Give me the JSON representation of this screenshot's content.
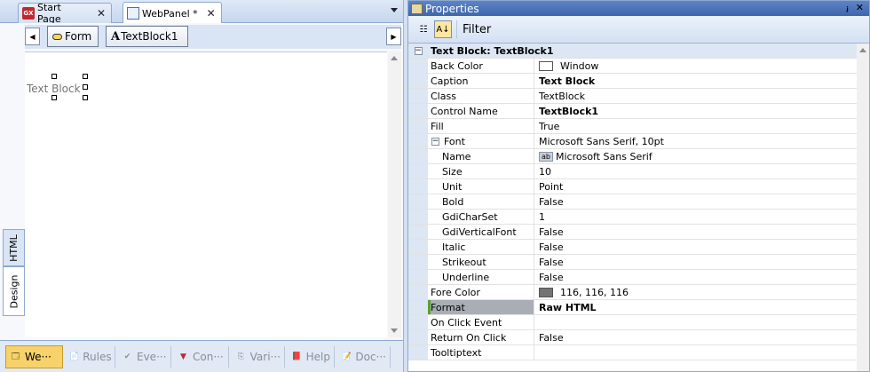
{
  "doc_tabs": [
    {
      "label": "Start Page",
      "icon": "gx-icon",
      "icon_text": "GX",
      "active": false
    },
    {
      "label": "WebPanel *",
      "icon": "webpanel-icon",
      "active": true
    }
  ],
  "designer": {
    "controls": {
      "form": "Form",
      "textblock_prefix": "A",
      "textblock": "TextBlock1"
    },
    "canvas_text": "Text Block",
    "side_tabs": {
      "html": "HTML",
      "design": "Design"
    }
  },
  "bottom_tabs": [
    {
      "label": "We···",
      "icon": "webform-icon",
      "active": true
    },
    {
      "label": "Rules",
      "icon": "rules-icon",
      "active": false
    },
    {
      "label": "Eve···",
      "icon": "events-icon",
      "active": false
    },
    {
      "label": "Con···",
      "icon": "conditions-icon",
      "active": false
    },
    {
      "label": "Vari···",
      "icon": "variables-icon",
      "active": false
    },
    {
      "label": "Help",
      "icon": "help-icon",
      "active": false
    },
    {
      "label": "Doc···",
      "icon": "documentation-icon",
      "active": false
    }
  ],
  "properties": {
    "title": "Properties",
    "pin_glyph": "ⱼ",
    "close_glyph": "✕",
    "toolbar": {
      "filter": "Filter"
    },
    "category": "Text Block: TextBlock1",
    "rows": [
      {
        "name": "Back Color",
        "value": "Window",
        "swatch": "#ffffff"
      },
      {
        "name": "Caption",
        "value": "Text Block",
        "bold": true
      },
      {
        "name": "Class",
        "value": "TextBlock"
      },
      {
        "name": "Control Name",
        "value": "TextBlock1",
        "bold": true
      },
      {
        "name": "Fill",
        "value": "True"
      },
      {
        "name": "Font",
        "value": "Microsoft Sans Serif, 10pt",
        "expanded": true
      },
      {
        "name": "Name",
        "value": "Microsoft Sans Serif",
        "sub": true,
        "ab": true
      },
      {
        "name": "Size",
        "value": "10",
        "sub": true
      },
      {
        "name": "Unit",
        "value": "Point",
        "sub": true
      },
      {
        "name": "Bold",
        "value": "False",
        "sub": true
      },
      {
        "name": "GdiCharSet",
        "value": "1",
        "sub": true
      },
      {
        "name": "GdiVerticalFont",
        "value": "False",
        "sub": true
      },
      {
        "name": "Italic",
        "value": "False",
        "sub": true
      },
      {
        "name": "Strikeout",
        "value": "False",
        "sub": true
      },
      {
        "name": "Underline",
        "value": "False",
        "sub": true
      },
      {
        "name": "Fore Color",
        "value": "116, 116, 116",
        "swatch": "#747474"
      },
      {
        "name": "Format",
        "value": "Raw HTML",
        "bold": true,
        "selected": true
      },
      {
        "name": "On Click Event",
        "value": ""
      },
      {
        "name": "Return On Click",
        "value": "False"
      },
      {
        "name": "Tooltiptext",
        "value": ""
      }
    ]
  },
  "colors": {
    "accent": "#f7d26a",
    "title_bar": "#4a72b8",
    "selection_marker": "#5aa02c"
  }
}
